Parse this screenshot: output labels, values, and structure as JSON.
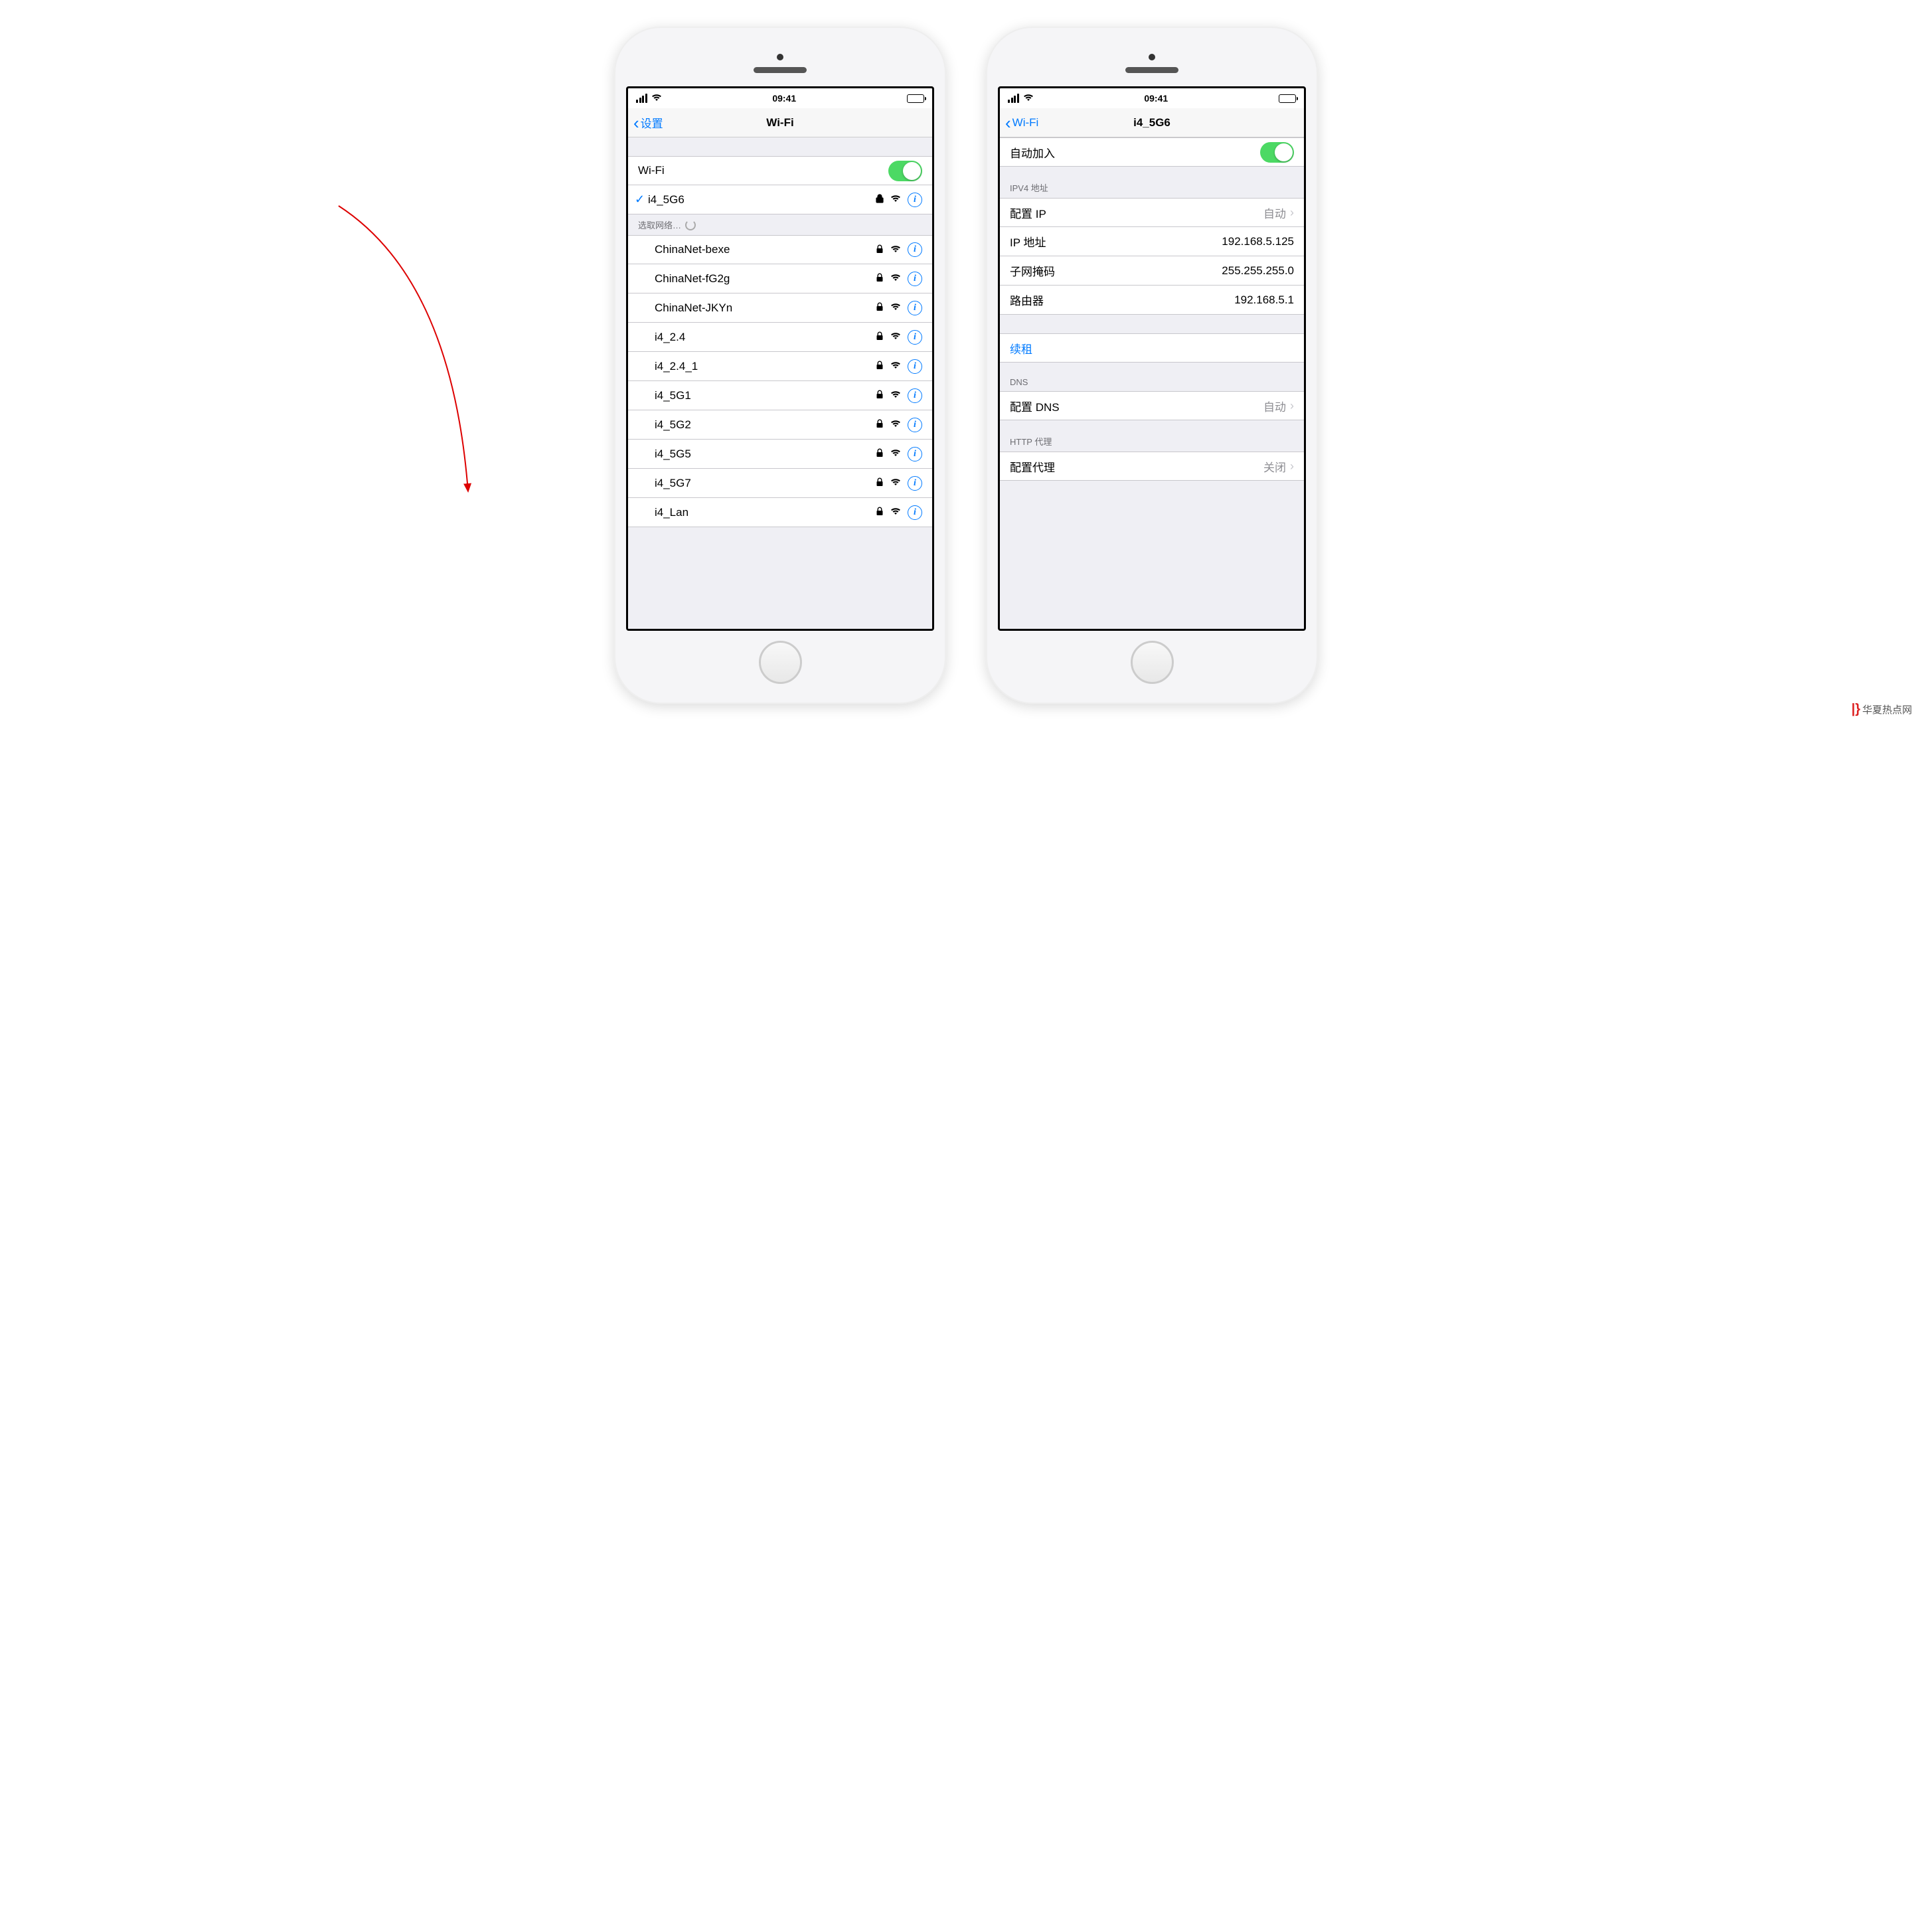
{
  "status": {
    "time": "09:41"
  },
  "left_phone": {
    "back_label": "设置",
    "title": "Wi-Fi",
    "wifi_toggle_label": "Wi-Fi",
    "current_network": "i4_5G6",
    "choose_header": "选取网络…",
    "networks": [
      "ChinaNet-bexe",
      "ChinaNet-fG2g",
      "ChinaNet-JKYn",
      "i4_2.4",
      "i4_2.4_1",
      "i4_5G1",
      "i4_5G2",
      "i4_5G5",
      "i4_5G7",
      "i4_Lan"
    ]
  },
  "right_phone": {
    "back_label": "Wi-Fi",
    "title": "i4_5G6",
    "auto_join_label": "自动加入",
    "ipv4_header": "IPV4 地址",
    "config_ip_label": "配置 IP",
    "config_ip_value": "自动",
    "ip_label": "IP 地址",
    "ip_value": "192.168.5.125",
    "mask_label": "子网掩码",
    "mask_value": "255.255.255.0",
    "router_label": "路由器",
    "router_value": "192.168.5.1",
    "renew_label": "续租",
    "dns_header": "DNS",
    "config_dns_label": "配置 DNS",
    "config_dns_value": "自动",
    "proxy_header": "HTTP 代理",
    "config_proxy_label": "配置代理",
    "config_proxy_value": "关闭"
  },
  "watermark": "华夏热点网"
}
